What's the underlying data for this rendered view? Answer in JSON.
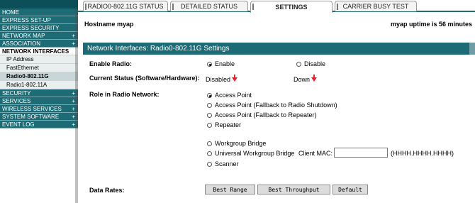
{
  "sidebar": {
    "items": [
      {
        "label": "HOME",
        "plus": ""
      },
      {
        "label": "EXPRESS SET-UP",
        "plus": ""
      },
      {
        "label": "EXPRESS SECURITY",
        "plus": ""
      },
      {
        "label": "NETWORK MAP",
        "plus": "+"
      },
      {
        "label": "ASSOCIATION",
        "plus": "+"
      },
      {
        "label": "NETWORK INTERFACES",
        "plus": ""
      }
    ],
    "subitems": [
      "IP Address",
      "FastEthernet",
      "Radio0-802.11G",
      "Radio1-802.11A"
    ],
    "items_after": [
      {
        "label": "SECURITY",
        "plus": "+"
      },
      {
        "label": "SERVICES",
        "plus": "+"
      },
      {
        "label": "WIRELESS SERVICES",
        "plus": "+"
      },
      {
        "label": "SYSTEM SOFTWARE",
        "plus": "+"
      },
      {
        "label": "EVENT LOG",
        "plus": "+"
      }
    ]
  },
  "tabs": {
    "status": "RADIO0-802.11G STATUS",
    "detailed": "DETAILED STATUS",
    "settings": "SETTINGS",
    "carrier": "CARRIER BUSY TEST"
  },
  "header": {
    "hostname": "Hostname myap",
    "uptime": "myap uptime is 56 minutes"
  },
  "panel": {
    "title": "Network Interfaces: Radio0-802.11G Settings",
    "enable_radio_label": "Enable Radio:",
    "enable": "Enable",
    "disable": "Disable",
    "current_status_label": "Current Status (Software/Hardware):",
    "software_status": "Disabled",
    "hardware_status": "Down",
    "role_label": "Role in Radio Network:",
    "roles": [
      "Access Point",
      "Access Point (Fallback to Radio Shutdown)",
      "Access Point (Fallback to Repeater)",
      "Repeater",
      "Workgroup Bridge",
      "Universal Workgroup Bridge",
      "Scanner"
    ],
    "client_mac_label": "Client MAC:",
    "client_mac_value": "",
    "client_mac_hint": "(HHHH.HHHH.HHHH)",
    "data_rates_label": "Data Rates:",
    "buttons": {
      "best_range": "Best Range",
      "best_throughput": "Best Throughput",
      "default": "Default"
    }
  },
  "colors": {
    "accent": "#1c6b75",
    "down_arrow": "#ee2222"
  }
}
